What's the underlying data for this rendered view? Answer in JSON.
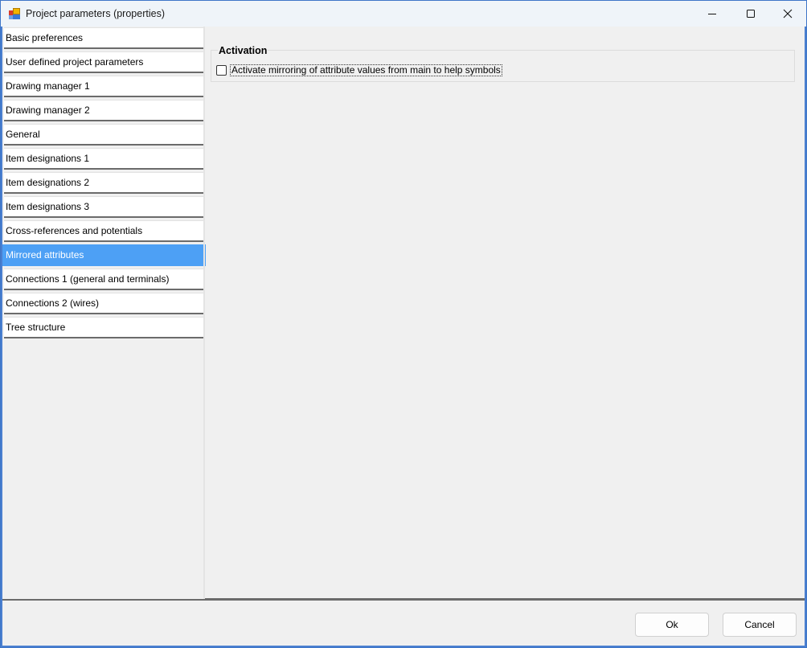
{
  "window": {
    "title": "Project parameters (properties)",
    "controls": {
      "minimize": "minimize",
      "maximize": "maximize",
      "close": "close"
    }
  },
  "sidebar": {
    "selected_index": 9,
    "items": [
      {
        "label": "Basic preferences"
      },
      {
        "label": "User defined project parameters"
      },
      {
        "label": "Drawing manager 1"
      },
      {
        "label": "Drawing manager 2"
      },
      {
        "label": "General"
      },
      {
        "label": "Item designations 1"
      },
      {
        "label": "Item designations 2"
      },
      {
        "label": "Item designations 3"
      },
      {
        "label": "Cross-references and potentials"
      },
      {
        "label": "Mirrored attributes"
      },
      {
        "label": "Connections 1 (general and terminals)"
      },
      {
        "label": "Connections 2 (wires)"
      },
      {
        "label": "Tree structure"
      }
    ]
  },
  "content": {
    "group_title": "Activation",
    "checkbox": {
      "label": "Activate mirroring of attribute values from main to help symbols",
      "checked": false
    }
  },
  "footer": {
    "ok_label": "Ok",
    "cancel_label": "Cancel"
  }
}
